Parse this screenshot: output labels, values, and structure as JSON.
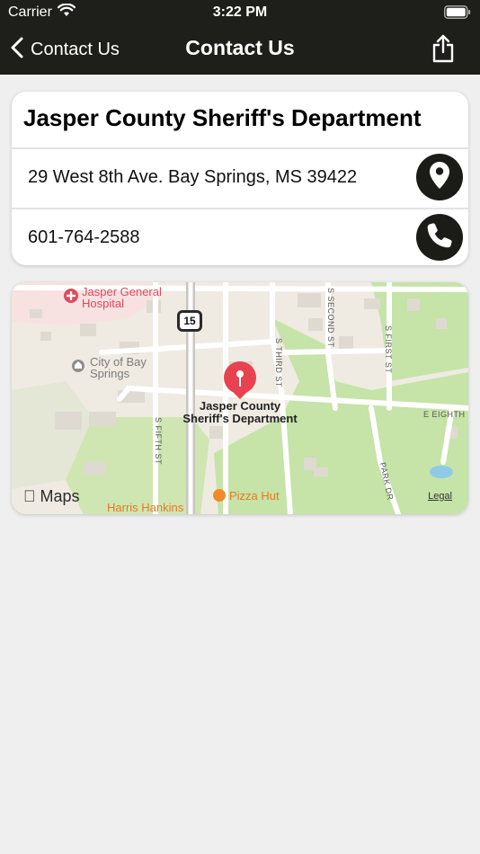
{
  "status_bar": {
    "carrier": "Carrier",
    "time": "3:22 PM"
  },
  "nav": {
    "back_label": "Contact Us",
    "title": "Contact Us"
  },
  "contact": {
    "name": "Jasper County Sheriff's Department",
    "address": "29 West 8th Ave. Bay Springs, MS 39422",
    "phone": "601-764-2588"
  },
  "map": {
    "pois": {
      "hospital": "Jasper General Hospital",
      "hospital_line1": "Jasper General",
      "hospital_line2": "Hospital",
      "city_line1": "City of Bay",
      "city_line2": "Springs",
      "pin_line1": "Jasper County",
      "pin_line2": "Sheriff's Department",
      "pizza": "Pizza Hut",
      "harris": "Harris Hankins"
    },
    "streets": {
      "s_second": "S SECOND ST",
      "s_first": "S FIRST ST",
      "s_third": "S THIRD ST",
      "s_fifth": "S FIFTH ST",
      "e_eighth": "E EIGHTH",
      "park_dr": "PARK DR"
    },
    "route_shield": "15",
    "maps_brand": "Maps",
    "legal": "Legal"
  },
  "colors": {
    "bar_bg": "#1e1e1b",
    "page_bg": "#efefef",
    "pin_red": "#e8414f",
    "park_green": "#c6e3a8"
  }
}
